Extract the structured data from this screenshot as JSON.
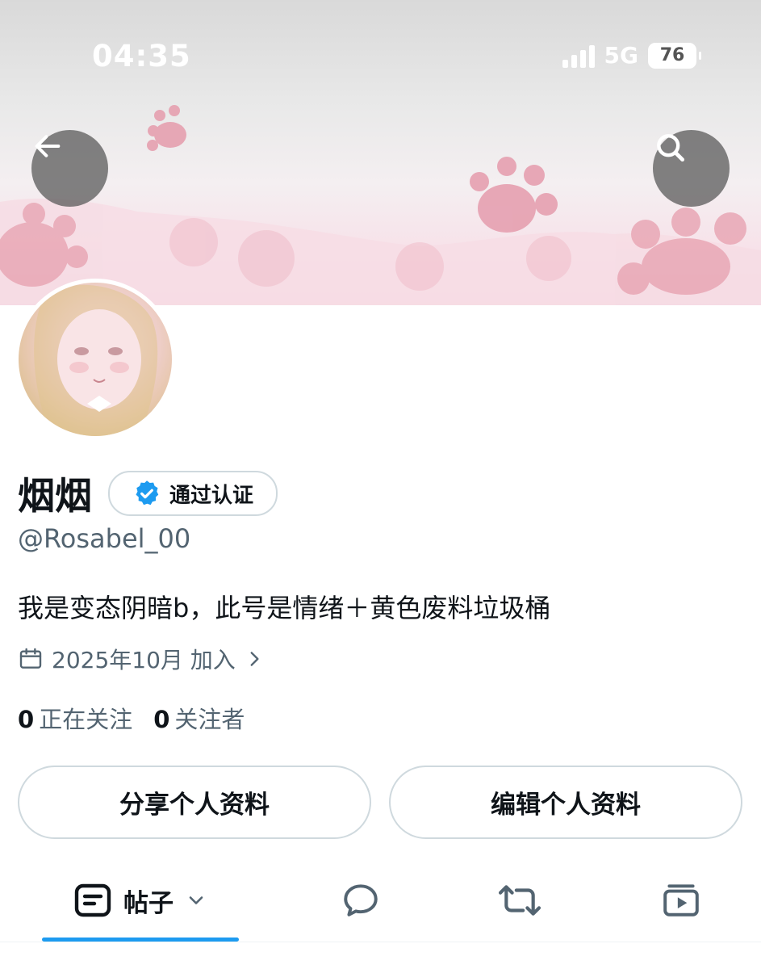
{
  "status_bar": {
    "time": "04:35",
    "network": "5G",
    "battery": "76"
  },
  "profile": {
    "display_name": "烟烟",
    "verified_label": "通过认证",
    "handle": "@Rosabel_00",
    "bio": "我是变态阴暗b，此号是情绪＋黄色废料垃圾桶",
    "joined": "2025年10月 加入",
    "following_count": "0",
    "following_label": "正在关注",
    "followers_count": "0",
    "followers_label": "关注者"
  },
  "actions": {
    "share_label": "分享个人资料",
    "edit_label": "编辑个人资料"
  },
  "tabs": {
    "posts_label": "帖子",
    "icons": [
      "posts-icon",
      "replies-icon",
      "reposts-icon",
      "media-icon"
    ]
  },
  "colors": {
    "accent": "#1d9bf0",
    "text_primary": "#0f1419",
    "text_secondary": "#536471",
    "border": "#cfd9de",
    "banner_pink": "#e79aac"
  }
}
